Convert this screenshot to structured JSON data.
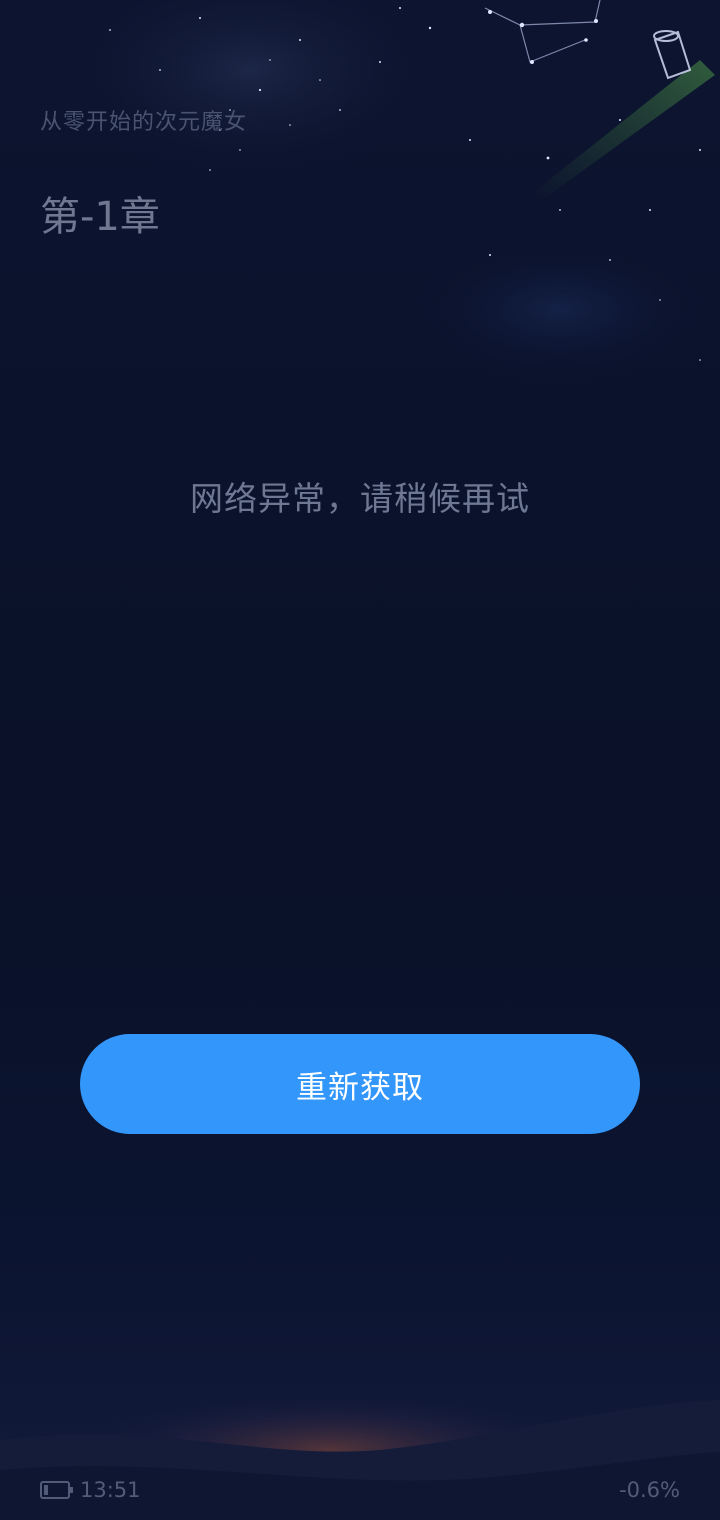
{
  "reader": {
    "book_title": "从零开始的次元魔女",
    "chapter_title": "第-1章"
  },
  "error": {
    "message": "网络异常，请稍候再试"
  },
  "retry_button": {
    "label": "重新获取"
  },
  "status_bar": {
    "time": "13:51",
    "progress": "-0.6%",
    "battery_icon": "battery-icon"
  },
  "colors": {
    "background": "#0b1229",
    "accent": "#3396fb",
    "muted_text": "#6e7893"
  }
}
